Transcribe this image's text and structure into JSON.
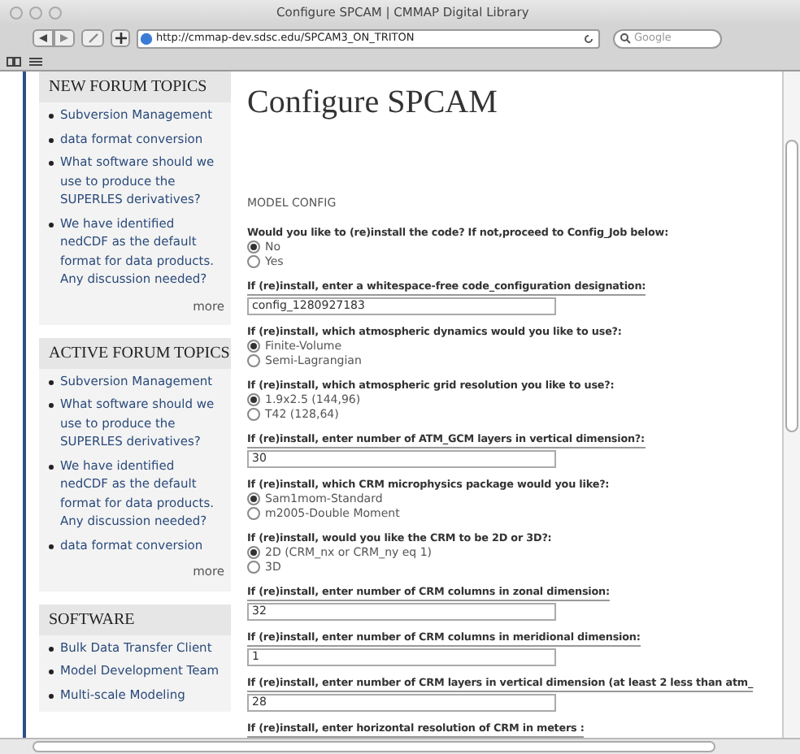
{
  "window": {
    "title": "Configure SPCAM | CMMAP Digital Library"
  },
  "toolbar": {
    "url": "http://cmmap-dev.sdsc.edu/SPCAM3_ON_TRITON",
    "search": {
      "placeholder": "Google"
    }
  },
  "sidebar": {
    "blocks": [
      {
        "title": "NEW FORUM TOPICS",
        "items": [
          "Subversion Management",
          "data format conversion",
          "What software should we use to produce the SUPERLES derivatives?",
          "We have identified nedCDF as the default format for data products. Any discussion needed?"
        ],
        "more": "more"
      },
      {
        "title": "ACTIVE FORUM TOPICS",
        "items": [
          "Subversion Management",
          "What software should we use to produce the SUPERLES derivatives?",
          "We have identified nedCDF as the default format for data products. Any discussion needed?",
          "data format conversion"
        ],
        "more": "more"
      },
      {
        "title": "SOFTWARE",
        "items": [
          "Bulk Data Transfer Client",
          "Model Development Team",
          "Multi-scale Modeling"
        ]
      }
    ]
  },
  "main": {
    "heading": "Configure SPCAM",
    "section": "MODEL CONFIG",
    "fields": [
      {
        "kind": "radio",
        "label": "Would you like to (re)install the code? If not,proceed to Config_Job below:",
        "options": [
          {
            "label": "No",
            "selected": true
          },
          {
            "label": "Yes",
            "selected": false
          }
        ]
      },
      {
        "kind": "text",
        "label": "If (re)install, enter a whitespace-free code_configuration designation:",
        "value": "config_1280927183"
      },
      {
        "kind": "radio",
        "label": "If (re)install, which atmospheric dynamics would you like to use?:",
        "options": [
          {
            "label": "Finite-Volume",
            "selected": true
          },
          {
            "label": "Semi-Lagrangian",
            "selected": false
          }
        ]
      },
      {
        "kind": "radio",
        "label": "If (re)install, which atmospheric grid resolution you like to use?:",
        "options": [
          {
            "label": "1.9x2.5 (144,96)",
            "selected": true
          },
          {
            "label": "T42 (128,64)",
            "selected": false
          }
        ]
      },
      {
        "kind": "text",
        "label": "If (re)install, enter number of ATM_GCM layers in vertical dimension?:",
        "value": "30"
      },
      {
        "kind": "radio",
        "label": "If (re)install, which CRM microphysics package would you like?:",
        "options": [
          {
            "label": "Sam1mom-Standard",
            "selected": true
          },
          {
            "label": "m2005-Double Moment",
            "selected": false
          }
        ]
      },
      {
        "kind": "radio",
        "label": "If (re)install, would you like the CRM to be 2D or 3D?:",
        "options": [
          {
            "label": "2D (CRM_nx or CRM_ny eq 1)",
            "selected": true
          },
          {
            "label": "3D",
            "selected": false
          }
        ]
      },
      {
        "kind": "text",
        "label": "If (re)install, enter number of CRM columns in zonal dimension:",
        "value": "32"
      },
      {
        "kind": "text",
        "label": "If (re)install, enter number of CRM columns in meridional dimension:",
        "value": "1"
      },
      {
        "kind": "text",
        "label": "If (re)install, enter number of CRM layers in vertical dimension (at least 2 less than atm_",
        "value": "28"
      },
      {
        "kind": "label",
        "label": "If (re)install, enter horizontal resolution of CRM in meters :"
      }
    ]
  }
}
